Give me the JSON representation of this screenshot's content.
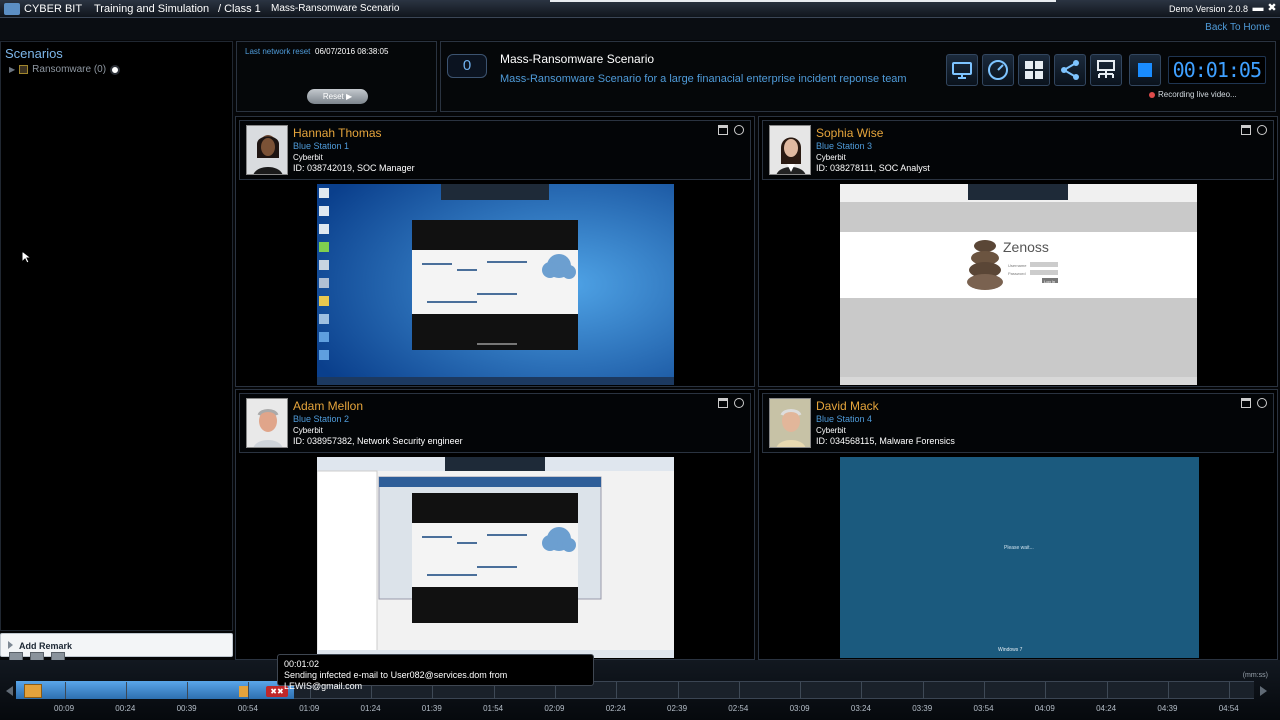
{
  "titlebar": {
    "app": "CYBER BIT",
    "section": "Training and Simulation",
    "class_label": "/ Class 1",
    "scenario": "Mass-Ransomware Scenario",
    "version": "Demo Version 2.0.8",
    "minimize": "▬",
    "close": "✖",
    "back_link": "Back To Home"
  },
  "sidebar": {
    "header": "Scenarios",
    "items": [
      {
        "label": "Ransomware (0)"
      }
    ]
  },
  "reset_panel": {
    "label": "Last network reset",
    "datetime": "06/07/2016 08:38:05",
    "button": "Reset"
  },
  "scenario_panel": {
    "counter": "0",
    "title": "Mass-Ransomware Scenario",
    "description": "Mass-Ransomware Scenario for a large finanacial enterprise incident reponse team",
    "timer": "00:01:05",
    "recording": "Recording live video..."
  },
  "stations": [
    {
      "name": "Hannah Thomas",
      "station": "Blue Station 1",
      "org": "Cyberbit",
      "id": "ID: 038742019, SOC Manager"
    },
    {
      "name": "Sophia Wise",
      "station": "Blue Station 3",
      "org": "Cyberbit",
      "id": "ID: 038278111, SOC Analyst"
    },
    {
      "name": "Adam Mellon",
      "station": "Blue Station 2",
      "org": "Cyberbit",
      "id": "ID: 038957382, Network Security engineer"
    },
    {
      "name": "David Mack",
      "station": "Blue Station 4",
      "org": "Cyberbit",
      "id": "ID: 034568115, Malware Forensics"
    }
  ],
  "screens": {
    "zenoss_brand": "Zenoss",
    "zenoss_user": "Username",
    "zenoss_pass": "Password",
    "zenoss_login": "Log In",
    "david_status": "Please wait...",
    "windows_label": "Windows 7"
  },
  "remark": {
    "label": "Add Remark"
  },
  "timeline": {
    "tooltip_time": "00:01:02",
    "tooltip_text": "Sending infected e-mail to User082@services.dom from LEWIS@gmail.com",
    "units": "(mm:ss)",
    "ticks": [
      "00:09",
      "00:24",
      "00:39",
      "00:54",
      "01:09",
      "01:24",
      "01:39",
      "01:54",
      "02:09",
      "02:24",
      "02:39",
      "02:54",
      "03:09",
      "03:24",
      "03:39",
      "03:54",
      "04:09",
      "04:24",
      "04:39",
      "04:54"
    ]
  },
  "colors": {
    "accent_blue": "#4f9bd9",
    "name_orange": "#e6a53c",
    "timer_blue": "#3fa0ff"
  }
}
